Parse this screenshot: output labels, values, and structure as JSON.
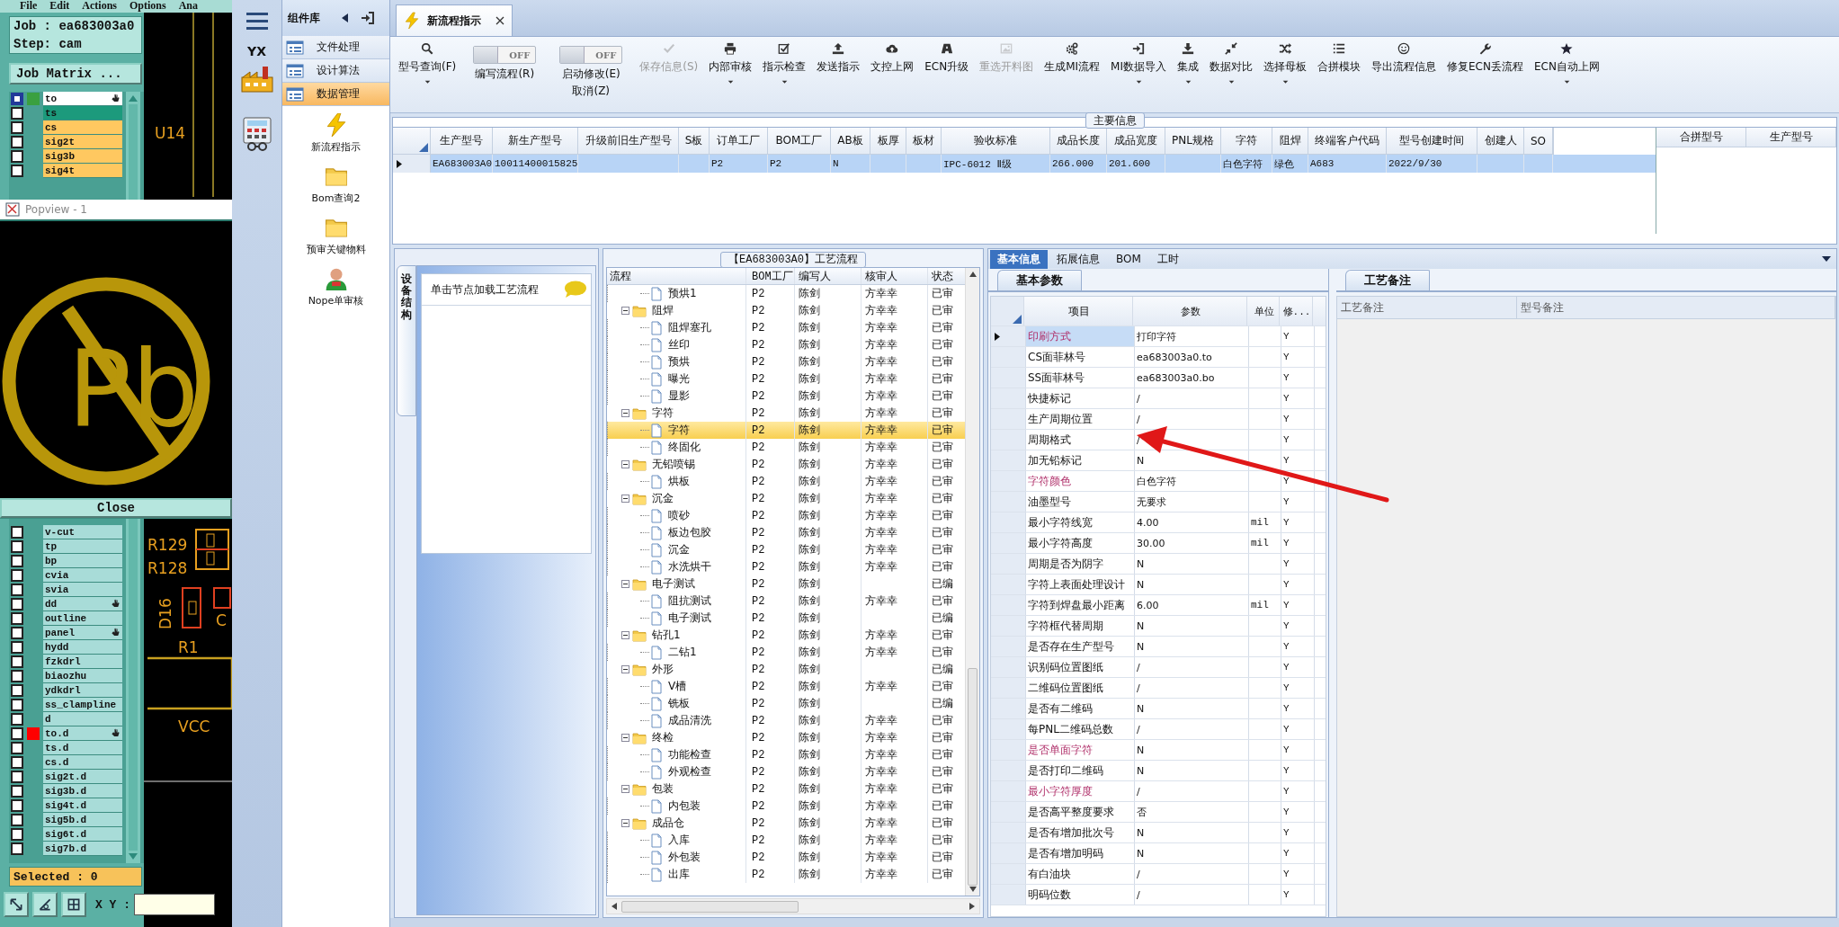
{
  "cam": {
    "menu": [
      "File",
      "Edit",
      "Actions",
      "Options",
      "Ana"
    ],
    "job": "Job : ea683003a0",
    "step": "Step: cam",
    "matrix_button": "Job Matrix ...",
    "layers_top": [
      {
        "name": "to",
        "color": "#ffffff",
        "selected": true,
        "marker": {
          "color": "#3aa040"
        },
        "edit_mark": true
      },
      {
        "name": "ts",
        "color": "#1c9a7c",
        "selected": false,
        "edit_mark": false
      },
      {
        "name": "cs",
        "color": "#ffc860",
        "selected": false,
        "edit_mark": false
      },
      {
        "name": "sig2t",
        "color": "#ffc860",
        "selected": false,
        "edit_mark": false
      },
      {
        "name": "sig3b",
        "color": "#ffc860",
        "selected": false,
        "edit_mark": false
      },
      {
        "name": "sig4t",
        "color": "#ffc860",
        "selected": false,
        "edit_mark": false
      }
    ],
    "layers_bottom": [
      {
        "name": "v-cut",
        "color": "#a8dcd8",
        "selected": false,
        "edit_mark": false
      },
      {
        "name": "tp",
        "color": "#a8dcd8",
        "selected": false,
        "edit_mark": false
      },
      {
        "name": "bp",
        "color": "#a8dcd8",
        "selected": false,
        "edit_mark": false
      },
      {
        "name": "cvia",
        "color": "#a8dcd8",
        "selected": false,
        "edit_mark": false
      },
      {
        "name": "svia",
        "color": "#a8dcd8",
        "selected": false,
        "edit_mark": false
      },
      {
        "name": "dd",
        "color": "#a8dcd8",
        "selected": false,
        "edit_mark": true
      },
      {
        "name": "outline",
        "color": "#a8dcd8",
        "selected": false,
        "edit_mark": false
      },
      {
        "name": "panel",
        "color": "#a8dcd8",
        "selected": false,
        "edit_mark": true
      },
      {
        "name": "hydd",
        "color": "#a8dcd8",
        "selected": false,
        "edit_mark": false
      },
      {
        "name": "fzkdrl",
        "color": "#a8dcd8",
        "selected": false,
        "edit_mark": false
      },
      {
        "name": "biaozhu",
        "color": "#a8dcd8",
        "selected": false,
        "edit_mark": false
      },
      {
        "name": "ydkdrl",
        "color": "#a8dcd8",
        "selected": false,
        "edit_mark": false
      },
      {
        "name": "ss_clampline",
        "color": "#a8dcd8",
        "selected": false,
        "edit_mark": false
      },
      {
        "name": "d",
        "color": "#a8dcd8",
        "selected": false,
        "edit_mark": false
      },
      {
        "name": "to.d",
        "color": "#a8dcd8",
        "selected": false,
        "marker": {
          "color": "#ff0000"
        },
        "edit_mark": true
      },
      {
        "name": "ts.d",
        "color": "#a8dcd8",
        "selected": false,
        "edit_mark": false
      },
      {
        "name": "cs.d",
        "color": "#a8dcd8",
        "selected": false,
        "edit_mark": false
      },
      {
        "name": "sig2t.d",
        "color": "#a8dcd8",
        "selected": false,
        "edit_mark": false
      },
      {
        "name": "sig3b.d",
        "color": "#a8dcd8",
        "selected": false,
        "edit_mark": false
      },
      {
        "name": "sig4t.d",
        "color": "#a8dcd8",
        "selected": false,
        "edit_mark": false
      },
      {
        "name": "sig5b.d",
        "color": "#a8dcd8",
        "selected": false,
        "edit_mark": false
      },
      {
        "name": "sig6t.d",
        "color": "#a8dcd8",
        "selected": false,
        "edit_mark": false
      },
      {
        "name": "sig7b.d",
        "color": "#a8dcd8",
        "selected": false,
        "edit_mark": false
      }
    ],
    "canvas_labels_top": [
      "U14"
    ],
    "canvas_labels_bottom": [
      "R129",
      "R128",
      "D16",
      "C",
      "R1",
      "VCC"
    ],
    "selected_count": "Selected : 0",
    "xy_label": "X Y :"
  },
  "popview": {
    "title": "Popview - 1",
    "symbol_text": "Pb",
    "close": "Close"
  },
  "icon_strip": {
    "logo_text": "YX"
  },
  "component_library": {
    "title": "组件库",
    "categories": [
      {
        "label": "文件处理",
        "selected": false
      },
      {
        "label": "设计算法",
        "selected": false
      },
      {
        "label": "数据管理",
        "selected": true
      }
    ],
    "tools": [
      "新流程指示",
      "Bom查询2",
      "预审关键物料",
      "Nope单审核"
    ]
  },
  "document_tabs": [
    {
      "label": "新流程指示",
      "selected": true
    }
  ],
  "toolbar": [
    {
      "kind": "button",
      "label": "型号查询(F)",
      "dropdown": true,
      "disabled": false
    },
    {
      "kind": "toggle",
      "label": "编写流程(R)",
      "state": "OFF",
      "on": false
    },
    {
      "kind": "toggle",
      "label": "启动修改(E)",
      "sublabel": "取消(Z)",
      "state": "OFF",
      "on": false
    },
    {
      "kind": "button",
      "label": "保存信息(S)",
      "dropdown": false,
      "disabled": true
    },
    {
      "kind": "button",
      "label": "内部审核",
      "dropdown": true,
      "disabled": false
    },
    {
      "kind": "button",
      "label": "指示检查",
      "dropdown": true,
      "disabled": false
    },
    {
      "kind": "button",
      "label": "发送指示",
      "dropdown": false,
      "disabled": false
    },
    {
      "kind": "button",
      "label": "文控上网",
      "dropdown": false,
      "disabled": false
    },
    {
      "kind": "button",
      "label": "ECN升级",
      "dropdown": false,
      "disabled": false
    },
    {
      "kind": "button",
      "label": "重选开料图",
      "dropdown": false,
      "disabled": true
    },
    {
      "kind": "button",
      "label": "生成MI流程",
      "dropdown": false,
      "disabled": false
    },
    {
      "kind": "button",
      "label": "MI数据导入",
      "dropdown": true,
      "disabled": false
    },
    {
      "kind": "button",
      "label": "集成",
      "dropdown": true,
      "disabled": false
    },
    {
      "kind": "button",
      "label": "数据对比",
      "dropdown": true,
      "disabled": false
    },
    {
      "kind": "button",
      "label": "选择母板",
      "dropdown": true,
      "disabled": false
    },
    {
      "kind": "button",
      "label": "合拼模块",
      "dropdown": false,
      "disabled": false
    },
    {
      "kind": "button",
      "label": "导出流程信息",
      "dropdown": false,
      "disabled": false
    },
    {
      "kind": "button",
      "label": "修复ECN丢流程",
      "dropdown": false,
      "disabled": false
    },
    {
      "kind": "button",
      "label": "ECN自动上网",
      "dropdown": true,
      "disabled": false
    }
  ],
  "main_info": {
    "title": "主要信息",
    "columns": [
      "生产型号",
      "新生产型号",
      "升级前旧生产型号",
      "S板",
      "订单工厂",
      "BOM工厂",
      "AB板",
      "板厚",
      "板材",
      "验收标准",
      "成品长度",
      "成品宽度",
      "PNL规格",
      "字符",
      "阻焊",
      "终端客户代码",
      "型号创建时间",
      "创建人",
      "SO"
    ],
    "rows": [
      {
        "selected": true,
        "cells": [
          "EA683003A0",
          "10011400015825",
          null,
          null,
          "P2",
          "P2",
          "N",
          null,
          null,
          "IPC-6012 Ⅱ级",
          "266.000",
          "201.600",
          null,
          "白色字符",
          "绿色",
          "A683",
          "2022/9/30",
          null,
          null
        ]
      }
    ],
    "merge_columns": [
      "合拼型号",
      "生产型号"
    ]
  },
  "device_pane": {
    "tab": "设备结构",
    "hint": "单击节点加载工艺流程"
  },
  "process_tree": {
    "title": "【EA683003A0】工艺流程",
    "columns": [
      "流程",
      "BOM工厂",
      "编写人",
      "核审人",
      "状态"
    ],
    "nodes": [
      {
        "label": "预烘1",
        "kind": "file",
        "bom": "P2",
        "writer": "陈剑",
        "reviewer": "方幸幸",
        "status": "已审",
        "selected": false
      },
      {
        "label": "阻焊",
        "kind": "folder",
        "expanded": true,
        "bom": "P2",
        "writer": "陈剑",
        "reviewer": "方幸幸",
        "status": "已审",
        "selected": false,
        "children": [
          {
            "label": "阻焊塞孔",
            "kind": "file",
            "bom": "P2",
            "writer": "陈剑",
            "reviewer": "方幸幸",
            "status": "已审",
            "selected": false
          },
          {
            "label": "丝印",
            "kind": "file",
            "bom": "P2",
            "writer": "陈剑",
            "reviewer": "方幸幸",
            "status": "已审",
            "selected": false
          },
          {
            "label": "预烘",
            "kind": "file",
            "bom": "P2",
            "writer": "陈剑",
            "reviewer": "方幸幸",
            "status": "已审",
            "selected": false
          },
          {
            "label": "曝光",
            "kind": "file",
            "bom": "P2",
            "writer": "陈剑",
            "reviewer": "方幸幸",
            "status": "已审",
            "selected": false
          },
          {
            "label": "显影",
            "kind": "file",
            "bom": "P2",
            "writer": "陈剑",
            "reviewer": "方幸幸",
            "status": "已审",
            "selected": false
          }
        ]
      },
      {
        "label": "字符",
        "kind": "folder",
        "expanded": true,
        "bom": "P2",
        "writer": "陈剑",
        "reviewer": "方幸幸",
        "status": "已审",
        "selected": false,
        "children": [
          {
            "label": "字符",
            "kind": "file",
            "bom": "P2",
            "writer": "陈剑",
            "reviewer": "方幸幸",
            "status": "已审",
            "selected": true
          },
          {
            "label": "终固化",
            "kind": "file",
            "bom": "P2",
            "writer": "陈剑",
            "reviewer": "方幸幸",
            "status": "已审",
            "selected": false
          }
        ]
      },
      {
        "label": "无铅喷锡",
        "kind": "folder",
        "expanded": true,
        "bom": "P2",
        "writer": "陈剑",
        "reviewer": "方幸幸",
        "status": "已审",
        "selected": false,
        "children": [
          {
            "label": "烘板",
            "kind": "file",
            "bom": "P2",
            "writer": "陈剑",
            "reviewer": "方幸幸",
            "status": "已审",
            "selected": false
          }
        ]
      },
      {
        "label": "沉金",
        "kind": "folder",
        "expanded": true,
        "bom": "P2",
        "writer": "陈剑",
        "reviewer": "方幸幸",
        "status": "已审",
        "selected": false,
        "children": [
          {
            "label": "喷砂",
            "kind": "file",
            "bom": "P2",
            "writer": "陈剑",
            "reviewer": "方幸幸",
            "status": "已审",
            "selected": false
          },
          {
            "label": "板边包胶",
            "kind": "file",
            "bom": "P2",
            "writer": "陈剑",
            "reviewer": "方幸幸",
            "status": "已审",
            "selected": false
          },
          {
            "label": "沉金",
            "kind": "file",
            "bom": "P2",
            "writer": "陈剑",
            "reviewer": "方幸幸",
            "status": "已审",
            "selected": false
          },
          {
            "label": "水洗烘干",
            "kind": "file",
            "bom": "P2",
            "writer": "陈剑",
            "reviewer": "方幸幸",
            "status": "已审",
            "selected": false
          }
        ]
      },
      {
        "label": "电子测试",
        "kind": "folder",
        "expanded": true,
        "bom": "P2",
        "writer": "陈剑",
        "status": "已编",
        "selected": false,
        "children": [
          {
            "label": "阻抗测试",
            "kind": "file",
            "bom": "P2",
            "writer": "陈剑",
            "reviewer": "方幸幸",
            "status": "已审",
            "selected": false
          },
          {
            "label": "电子测试",
            "kind": "file",
            "bom": "P2",
            "writer": "陈剑",
            "status": "已编",
            "selected": false
          }
        ]
      },
      {
        "label": "钻孔1",
        "kind": "folder",
        "expanded": true,
        "bom": "P2",
        "writer": "陈剑",
        "reviewer": "方幸幸",
        "status": "已审",
        "selected": false,
        "children": [
          {
            "label": "二钻1",
            "kind": "file",
            "bom": "P2",
            "writer": "陈剑",
            "reviewer": "方幸幸",
            "status": "已审",
            "selected": false
          }
        ]
      },
      {
        "label": "外形",
        "kind": "folder",
        "expanded": true,
        "bom": "P2",
        "writer": "陈剑",
        "status": "已编",
        "selected": false,
        "children": [
          {
            "label": "V槽",
            "kind": "file",
            "bom": "P2",
            "writer": "陈剑",
            "reviewer": "方幸幸",
            "status": "已审",
            "selected": false
          },
          {
            "label": "铣板",
            "kind": "file",
            "bom": "P2",
            "writer": "陈剑",
            "status": "已编",
            "selected": false
          },
          {
            "label": "成品清洗",
            "kind": "file",
            "bom": "P2",
            "writer": "陈剑",
            "reviewer": "方幸幸",
            "status": "已审",
            "selected": false
          }
        ]
      },
      {
        "label": "终检",
        "kind": "folder",
        "expanded": true,
        "bom": "P2",
        "writer": "陈剑",
        "reviewer": "方幸幸",
        "status": "已审",
        "selected": false,
        "children": [
          {
            "label": "功能检查",
            "kind": "file",
            "bom": "P2",
            "writer": "陈剑",
            "reviewer": "方幸幸",
            "status": "已审",
            "selected": false
          },
          {
            "label": "外观检查",
            "kind": "file",
            "bom": "P2",
            "writer": "陈剑",
            "reviewer": "方幸幸",
            "status": "已审",
            "selected": false
          }
        ]
      },
      {
        "label": "包装",
        "kind": "folder",
        "expanded": true,
        "bom": "P2",
        "writer": "陈剑",
        "reviewer": "方幸幸",
        "status": "已审",
        "selected": false,
        "children": [
          {
            "label": "内包装",
            "kind": "file",
            "bom": "P2",
            "writer": "陈剑",
            "reviewer": "方幸幸",
            "status": "已审",
            "selected": false
          }
        ]
      },
      {
        "label": "成品仓",
        "kind": "folder",
        "expanded": true,
        "bom": "P2",
        "writer": "陈剑",
        "reviewer": "方幸幸",
        "status": "已审",
        "selected": false,
        "children": [
          {
            "label": "入库",
            "kind": "file",
            "bom": "P2",
            "writer": "陈剑",
            "reviewer": "方幸幸",
            "status": "已审",
            "selected": false
          },
          {
            "label": "外包装",
            "kind": "file",
            "bom": "P2",
            "writer": "陈剑",
            "reviewer": "方幸幸",
            "status": "已审",
            "selected": false
          },
          {
            "label": "出库",
            "kind": "file",
            "bom": "P2",
            "writer": "陈剑",
            "reviewer": "方幸幸",
            "status": "已审",
            "selected": false
          }
        ]
      }
    ]
  },
  "detail_tabs": [
    {
      "label": "基本信息",
      "selected": true
    },
    {
      "label": "拓展信息",
      "selected": false
    },
    {
      "label": "BOM",
      "selected": false
    },
    {
      "label": "工时",
      "selected": false
    }
  ],
  "params": {
    "tab": "基本参数",
    "columns": [
      "项目",
      "参数",
      "单位",
      "修..."
    ],
    "rows": [
      {
        "item": "印刷方式",
        "value": "打印字符",
        "mod": "Y",
        "highlighted": true,
        "selected": true
      },
      {
        "item": "CS面菲林号",
        "value": "ea683003a0.to",
        "mod": "Y",
        "highlighted": false,
        "selected": false
      },
      {
        "item": "SS面菲林号",
        "value": "ea683003a0.bo",
        "mod": "Y",
        "highlighted": false,
        "selected": false
      },
      {
        "item": "快捷标记",
        "value": "/",
        "mod": "Y",
        "highlighted": false,
        "selected": false
      },
      {
        "item": "生产周期位置",
        "value": "/",
        "mod": "Y",
        "highlighted": false,
        "selected": false
      },
      {
        "item": "周期格式",
        "value": "/",
        "mod": "Y",
        "highlighted": false,
        "selected": false
      },
      {
        "item": "加无铅标记",
        "value": "N",
        "mod": "Y",
        "highlighted": false,
        "selected": false
      },
      {
        "item": "字符颜色",
        "value": "白色字符",
        "mod": "Y",
        "highlighted": true,
        "selected": false
      },
      {
        "item": "油墨型号",
        "value": "无要求",
        "mod": "Y",
        "highlighted": false,
        "selected": false
      },
      {
        "item": "最小字符线宽",
        "value": "4.00",
        "unit": "mil",
        "mod": "Y",
        "highlighted": false,
        "selected": false
      },
      {
        "item": "最小字符高度",
        "value": "30.00",
        "unit": "mil",
        "mod": "Y",
        "highlighted": false,
        "selected": false
      },
      {
        "item": "周期是否为阴字",
        "value": "N",
        "mod": "Y",
        "highlighted": false,
        "selected": false
      },
      {
        "item": "字符上表面处理设计",
        "value": "N",
        "mod": "Y",
        "highlighted": false,
        "selected": false
      },
      {
        "item": "字符到焊盘最小距离",
        "value": "6.00",
        "unit": "mil",
        "mod": "Y",
        "highlighted": false,
        "selected": false
      },
      {
        "item": "字符框代替周期",
        "value": "N",
        "mod": "Y",
        "highlighted": false,
        "selected": false
      },
      {
        "item": "是否存在生产型号",
        "value": "N",
        "mod": "Y",
        "highlighted": false,
        "selected": false
      },
      {
        "item": "识别码位置图纸",
        "value": "/",
        "mod": "Y",
        "highlighted": false,
        "selected": false
      },
      {
        "item": "二维码位置图纸",
        "value": "/",
        "mod": "Y",
        "highlighted": false,
        "selected": false
      },
      {
        "item": "是否有二维码",
        "value": "N",
        "mod": "Y",
        "highlighted": false,
        "selected": false
      },
      {
        "item": "每PNL二维码总数",
        "value": "/",
        "mod": "Y",
        "highlighted": false,
        "selected": false
      },
      {
        "item": "是否单面字符",
        "value": "N",
        "mod": "Y",
        "highlighted": true,
        "selected": false
      },
      {
        "item": "是否打印二维码",
        "value": "N",
        "mod": "Y",
        "highlighted": false,
        "selected": false
      },
      {
        "item": "最小字符厚度",
        "value": "/",
        "mod": "Y",
        "highlighted": true,
        "selected": false
      },
      {
        "item": "是否高平整度要求",
        "value": "否",
        "mod": "Y",
        "highlighted": false,
        "selected": false
      },
      {
        "item": "是否有增加批次号",
        "value": "N",
        "mod": "Y",
        "highlighted": false,
        "selected": false
      },
      {
        "item": "是否有增加明码",
        "value": "N",
        "mod": "Y",
        "highlighted": false,
        "selected": false
      },
      {
        "item": "有白油块",
        "value": "/",
        "mod": "Y",
        "highlighted": false,
        "selected": false
      },
      {
        "item": "明码位数",
        "value": "/",
        "mod": "Y",
        "highlighted": false,
        "selected": false
      }
    ]
  },
  "remarks": {
    "tab": "工艺备注",
    "columns": [
      "工艺备注",
      "型号备注"
    ]
  },
  "annotation": {
    "kind": "arrow"
  }
}
